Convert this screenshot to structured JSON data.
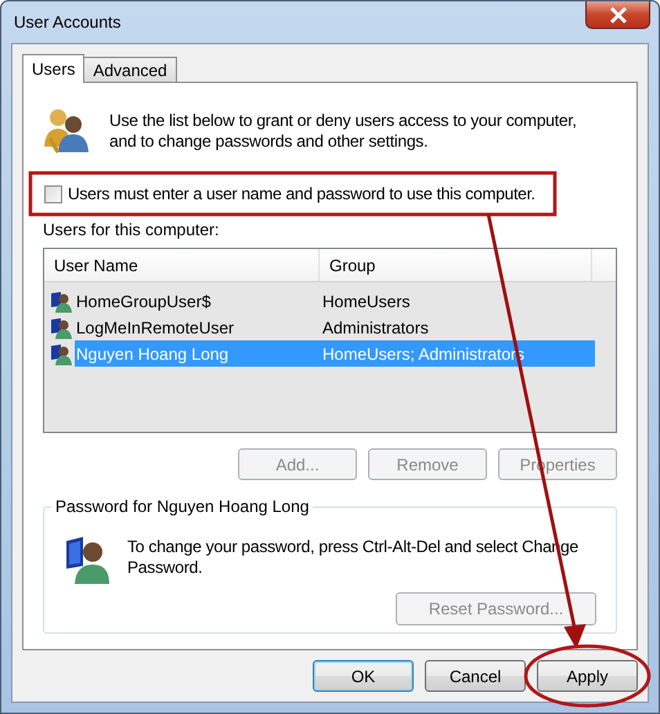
{
  "window": {
    "title": "User Accounts"
  },
  "tabs": [
    {
      "label": "Users",
      "selected": true
    },
    {
      "label": "Advanced",
      "selected": false
    }
  ],
  "intro": "Use the list below to grant or deny users access to your computer, and to change passwords and other settings.",
  "require_password": {
    "label": "Users must enter a user name and password to use this computer.",
    "checked": false
  },
  "users_label": "Users for this computer:",
  "users_table": {
    "columns": [
      "User Name",
      "Group"
    ],
    "rows": [
      {
        "user_name": "HomeGroupUser$",
        "group": "HomeUsers",
        "selected": false
      },
      {
        "user_name": "LogMeInRemoteUser",
        "group": "Administrators",
        "selected": false
      },
      {
        "user_name": "Nguyen Hoang Long",
        "group": "HomeUsers; Administrators",
        "selected": true
      }
    ]
  },
  "user_buttons": [
    {
      "label": "Add...",
      "disabled": true
    },
    {
      "label": "Remove",
      "disabled": true
    },
    {
      "label": "Properties",
      "disabled": true
    }
  ],
  "password_group": {
    "title": "Password for Nguyen Hoang Long",
    "text": "To change your password, press Ctrl-Alt-Del and select Change Password.",
    "button": {
      "label": "Reset Password...",
      "disabled": true
    }
  },
  "dialog_buttons": [
    {
      "label": "OK",
      "default": true
    },
    {
      "label": "Cancel",
      "default": false
    },
    {
      "label": "Apply",
      "default": false
    }
  ],
  "annotations": [
    {
      "kind": "frame"
    },
    {
      "kind": "arrow"
    },
    {
      "kind": "ellipse"
    }
  ]
}
